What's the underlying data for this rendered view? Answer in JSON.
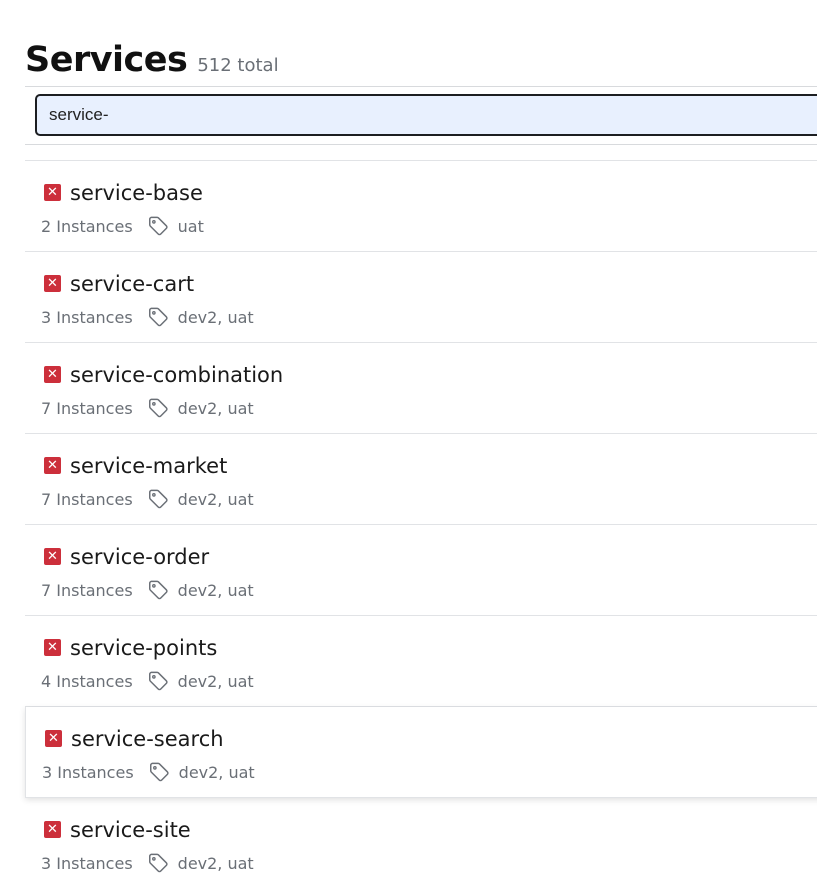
{
  "header": {
    "title": "Services",
    "count": "512 total"
  },
  "search": {
    "value": "service-"
  },
  "colors": {
    "status_error": "#cc2f3b"
  },
  "services": [
    {
      "name": "service-base",
      "instances": "2 Instances",
      "tags": "uat",
      "status_icon": "x-mark-icon"
    },
    {
      "name": "service-cart",
      "instances": "3 Instances",
      "tags": "dev2, uat",
      "status_icon": "x-mark-icon"
    },
    {
      "name": "service-combination",
      "instances": "7 Instances",
      "tags": "dev2, uat",
      "status_icon": "x-mark-icon"
    },
    {
      "name": "service-market",
      "instances": "7 Instances",
      "tags": "dev2, uat",
      "status_icon": "x-mark-icon"
    },
    {
      "name": "service-order",
      "instances": "7 Instances",
      "tags": "dev2, uat",
      "status_icon": "x-mark-icon"
    },
    {
      "name": "service-points",
      "instances": "4 Instances",
      "tags": "dev2, uat",
      "status_icon": "x-mark-icon"
    },
    {
      "name": "service-search",
      "instances": "3 Instances",
      "tags": "dev2, uat",
      "status_icon": "x-mark-icon"
    },
    {
      "name": "service-site",
      "instances": "3 Instances",
      "tags": "dev2, uat",
      "status_icon": "x-mark-icon"
    }
  ]
}
